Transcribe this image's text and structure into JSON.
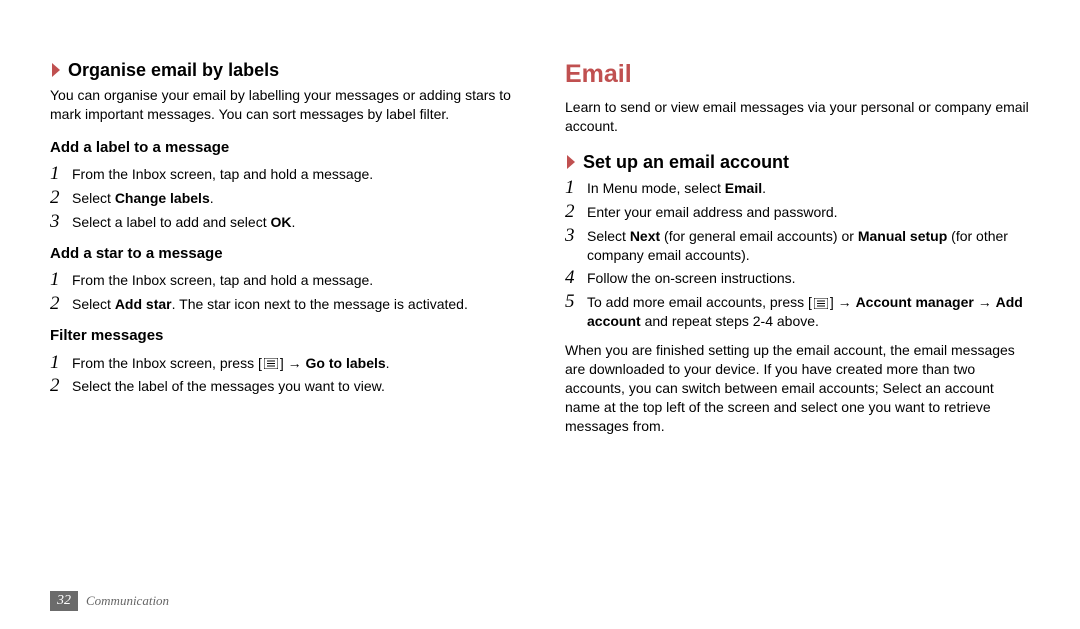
{
  "left": {
    "heading": "Organise email by labels",
    "intro": "You can organise your email by labelling your messages or adding stars to mark important messages. You can sort messages by label filter.",
    "groups": [
      {
        "title": "Add a label to a message",
        "steps": [
          {
            "n": "1",
            "pre": "From the Inbox screen, tap and hold a message."
          },
          {
            "n": "2",
            "pre": "Select ",
            "bold1": "Change labels",
            "post": "."
          },
          {
            "n": "3",
            "pre": "Select a label to add and select ",
            "bold1": "OK",
            "post": "."
          }
        ]
      },
      {
        "title": "Add a star to a message",
        "steps": [
          {
            "n": "1",
            "pre": "From the Inbox screen, tap and hold a message."
          },
          {
            "n": "2",
            "pre": "Select ",
            "bold1": "Add star",
            "post": ". The star icon next to the message is activated."
          }
        ]
      },
      {
        "title": "Filter messages",
        "steps": [
          {
            "n": "1",
            "pre": "From the Inbox screen, press [",
            "icon": true,
            "mid": "] → ",
            "bold1": "Go to labels",
            "post": "."
          },
          {
            "n": "2",
            "pre": "Select the label of the messages you want to view."
          }
        ]
      }
    ]
  },
  "right": {
    "title": "Email",
    "intro": "Learn to send or view email messages via your personal or company email account.",
    "heading": "Set up an email account",
    "steps": [
      {
        "n": "1",
        "pre": "In Menu mode, select ",
        "bold1": "Email",
        "post": "."
      },
      {
        "n": "2",
        "pre": "Enter your email address and password."
      },
      {
        "n": "3",
        "pre": "Select ",
        "bold1": "Next",
        "mid": " (for general email accounts) or ",
        "bold2": "Manual setup",
        "post": " (for other company email accounts)."
      },
      {
        "n": "4",
        "pre": "Follow the on-screen instructions."
      },
      {
        "n": "5",
        "pre": "To add more email accounts, press [",
        "icon": true,
        "mid": "] → ",
        "bold1": "Account manager",
        "mid2": " → ",
        "bold2": "Add account",
        "post": " and repeat steps 2-4 above."
      }
    ],
    "outro": "When you are finished setting up the email account, the email messages are downloaded to your device. If you have created more than two accounts, you can switch between email accounts; Select an account name at the top left of the screen and select one you want to retrieve messages from."
  },
  "footer": {
    "page": "32",
    "section": "Communication"
  }
}
